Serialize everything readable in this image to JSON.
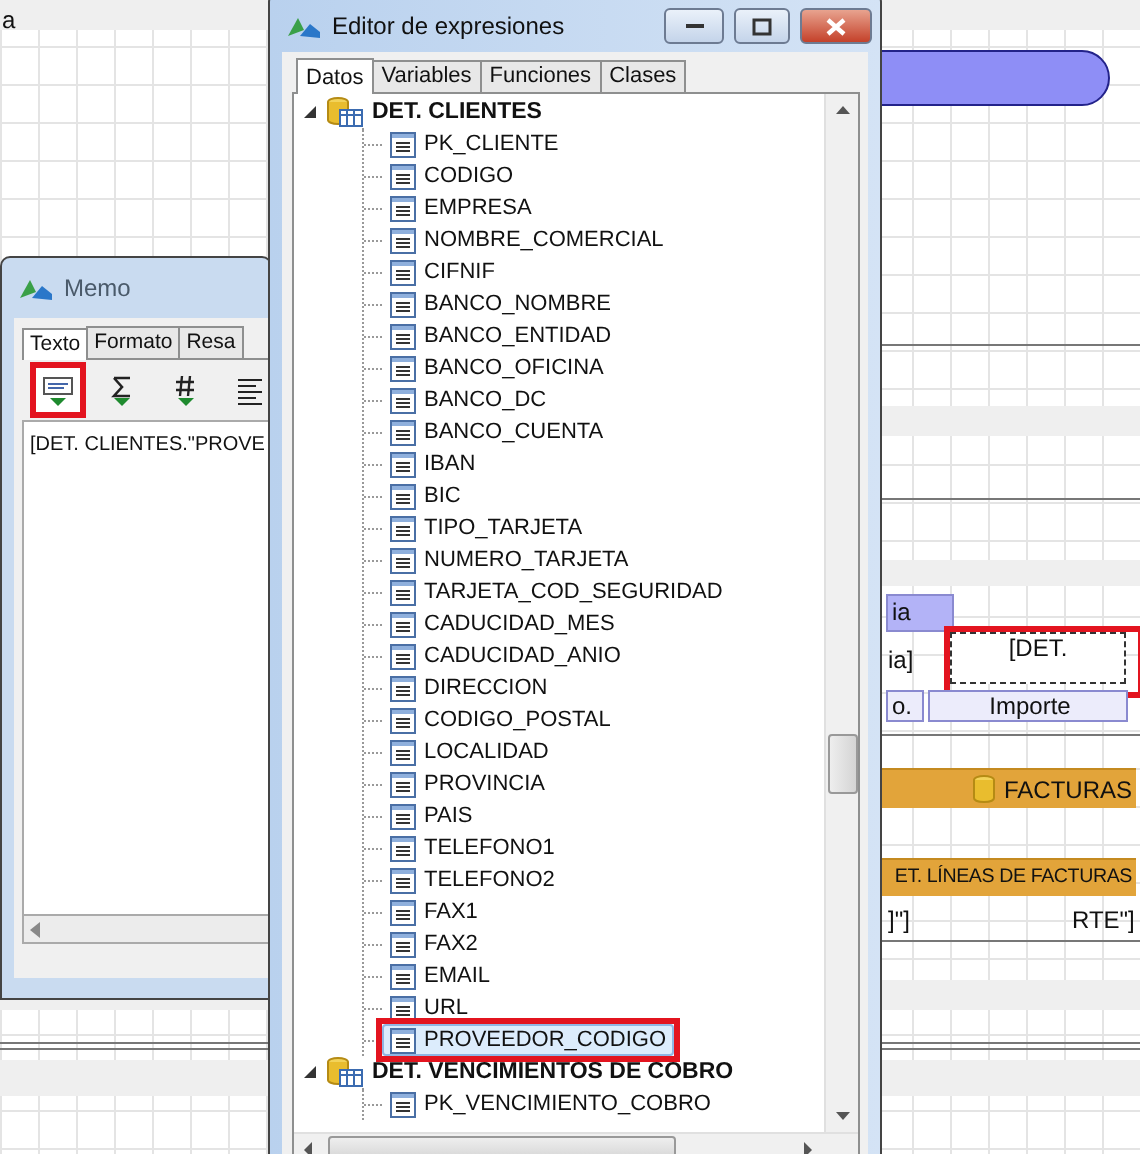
{
  "designer": {
    "top_band": "a",
    "cells": [
      {
        "kind": "label",
        "text": "ia"
      },
      {
        "kind": "text",
        "text": "ia]"
      },
      {
        "kind": "memo",
        "text": "[DET.",
        "annotated": true
      },
      {
        "kind": "label",
        "text": "o."
      },
      {
        "kind": "label",
        "text": "Importe"
      }
    ],
    "bands": [
      {
        "kind": "data",
        "text": "FACTURAS"
      },
      {
        "kind": "data",
        "text": "ET. LÍNEAS DE FACTURAS"
      }
    ],
    "fields": [
      "]\"]",
      "RTE\"]"
    ]
  },
  "memo": {
    "title": "Memo",
    "tabs": [
      {
        "label": "Texto",
        "selected": true
      },
      {
        "label": "Formato",
        "selected": false
      },
      {
        "label": "Resa",
        "selected": false
      }
    ],
    "toolbar": [
      {
        "kind": "insert-field",
        "annotated": true
      },
      {
        "kind": "sum",
        "annotated": false
      },
      {
        "kind": "number",
        "annotated": false
      },
      {
        "kind": "align",
        "annotated": false
      }
    ],
    "text": "[DET. CLIENTES.\"PROVE"
  },
  "editor": {
    "title": "Editor de expresiones",
    "tabs": [
      {
        "label": "Datos",
        "selected": true
      },
      {
        "label": "Variables",
        "selected": false
      },
      {
        "label": "Funciones",
        "selected": false
      },
      {
        "label": "Clases",
        "selected": false
      }
    ],
    "tree": [
      {
        "label": "DET. CLIENTES",
        "expanded": true,
        "children": [
          {
            "label": "PK_CLIENTE",
            "selected": false,
            "annotated": false
          },
          {
            "label": "CODIGO",
            "selected": false,
            "annotated": false
          },
          {
            "label": "EMPRESA",
            "selected": false,
            "annotated": false
          },
          {
            "label": "NOMBRE_COMERCIAL",
            "selected": false,
            "annotated": false
          },
          {
            "label": "CIFNIF",
            "selected": false,
            "annotated": false
          },
          {
            "label": "BANCO_NOMBRE",
            "selected": false,
            "annotated": false
          },
          {
            "label": "BANCO_ENTIDAD",
            "selected": false,
            "annotated": false
          },
          {
            "label": "BANCO_OFICINA",
            "selected": false,
            "annotated": false
          },
          {
            "label": "BANCO_DC",
            "selected": false,
            "annotated": false
          },
          {
            "label": "BANCO_CUENTA",
            "selected": false,
            "annotated": false
          },
          {
            "label": "IBAN",
            "selected": false,
            "annotated": false
          },
          {
            "label": "BIC",
            "selected": false,
            "annotated": false
          },
          {
            "label": "TIPO_TARJETA",
            "selected": false,
            "annotated": false
          },
          {
            "label": "NUMERO_TARJETA",
            "selected": false,
            "annotated": false
          },
          {
            "label": "TARJETA_COD_SEGURIDAD",
            "selected": false,
            "annotated": false
          },
          {
            "label": "CADUCIDAD_MES",
            "selected": false,
            "annotated": false
          },
          {
            "label": "CADUCIDAD_ANIO",
            "selected": false,
            "annotated": false
          },
          {
            "label": "DIRECCION",
            "selected": false,
            "annotated": false
          },
          {
            "label": "CODIGO_POSTAL",
            "selected": false,
            "annotated": false
          },
          {
            "label": "LOCALIDAD",
            "selected": false,
            "annotated": false
          },
          {
            "label": "PROVINCIA",
            "selected": false,
            "annotated": false
          },
          {
            "label": "PAIS",
            "selected": false,
            "annotated": false
          },
          {
            "label": "TELEFONO1",
            "selected": false,
            "annotated": false
          },
          {
            "label": "TELEFONO2",
            "selected": false,
            "annotated": false
          },
          {
            "label": "FAX1",
            "selected": false,
            "annotated": false
          },
          {
            "label": "FAX2",
            "selected": false,
            "annotated": false
          },
          {
            "label": "EMAIL",
            "selected": false,
            "annotated": false
          },
          {
            "label": "URL",
            "selected": false,
            "annotated": false
          },
          {
            "label": "PROVEEDOR_CODIGO",
            "selected": true,
            "annotated": true
          }
        ]
      },
      {
        "label": "DET. VENCIMIENTOS DE COBRO",
        "expanded": true,
        "children": [
          {
            "label": "PK_VENCIMIENTO_COBRO",
            "selected": false,
            "annotated": false
          }
        ]
      }
    ]
  }
}
